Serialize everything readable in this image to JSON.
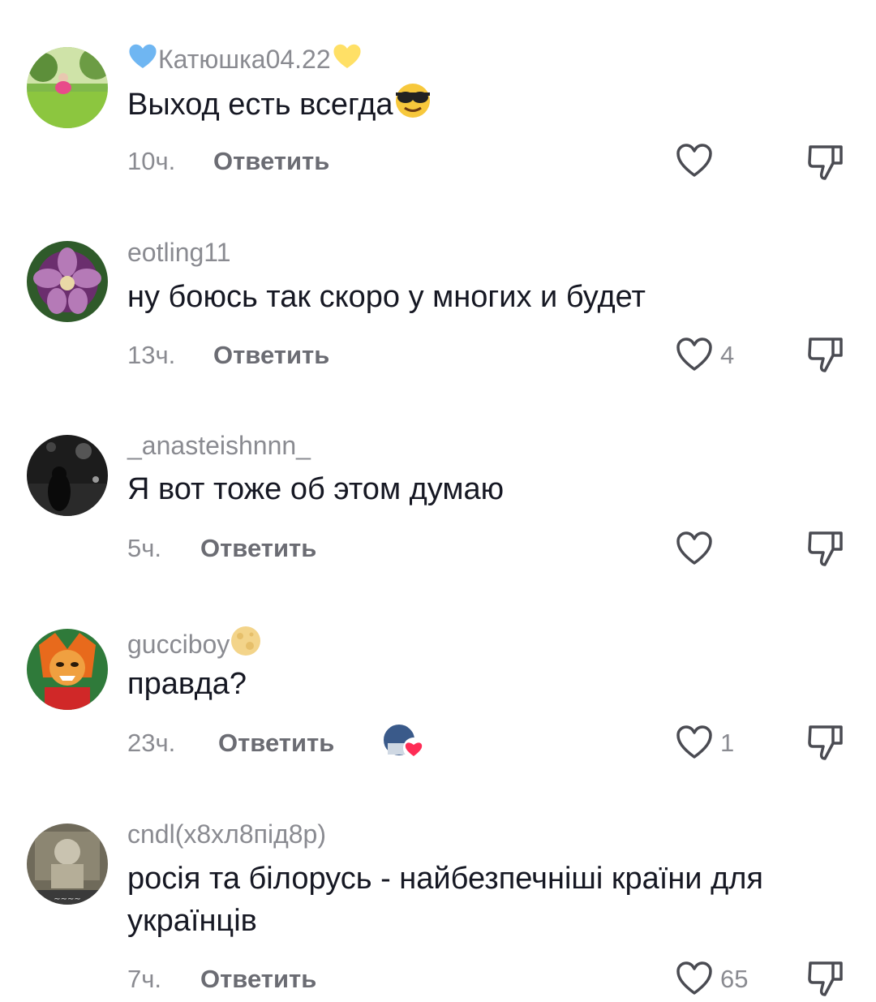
{
  "comments": [
    {
      "username": "Катюшка04.22",
      "text": "Выход есть всегда",
      "time": "10ч.",
      "reply_label": "Ответить",
      "likes": ""
    },
    {
      "username": "eotling11",
      "text": "ну боюсь так скоро у многих и будет",
      "time": "13ч.",
      "reply_label": "Ответить",
      "likes": "4"
    },
    {
      "username": "_anasteishnnn_",
      "text": "Я вот тоже об этом думаю",
      "time": "5ч.",
      "reply_label": "Ответить",
      "likes": ""
    },
    {
      "username": "gucciboy",
      "text": "правда?",
      "time": "23ч.",
      "reply_label": "Ответить",
      "likes": "1"
    },
    {
      "username": "cndl(х8хл8під8р)",
      "text": "росія та білорусь - найбезпечніші країни для українців",
      "time": "7ч.",
      "reply_label": "Ответить",
      "likes": "65"
    }
  ],
  "icons": {
    "like": "heart-outline-icon",
    "dislike": "thumbs-down-outline-icon"
  },
  "colors": {
    "text_primary": "#161823",
    "text_secondary": "#8a8b91",
    "reply": "#6b6c73"
  }
}
